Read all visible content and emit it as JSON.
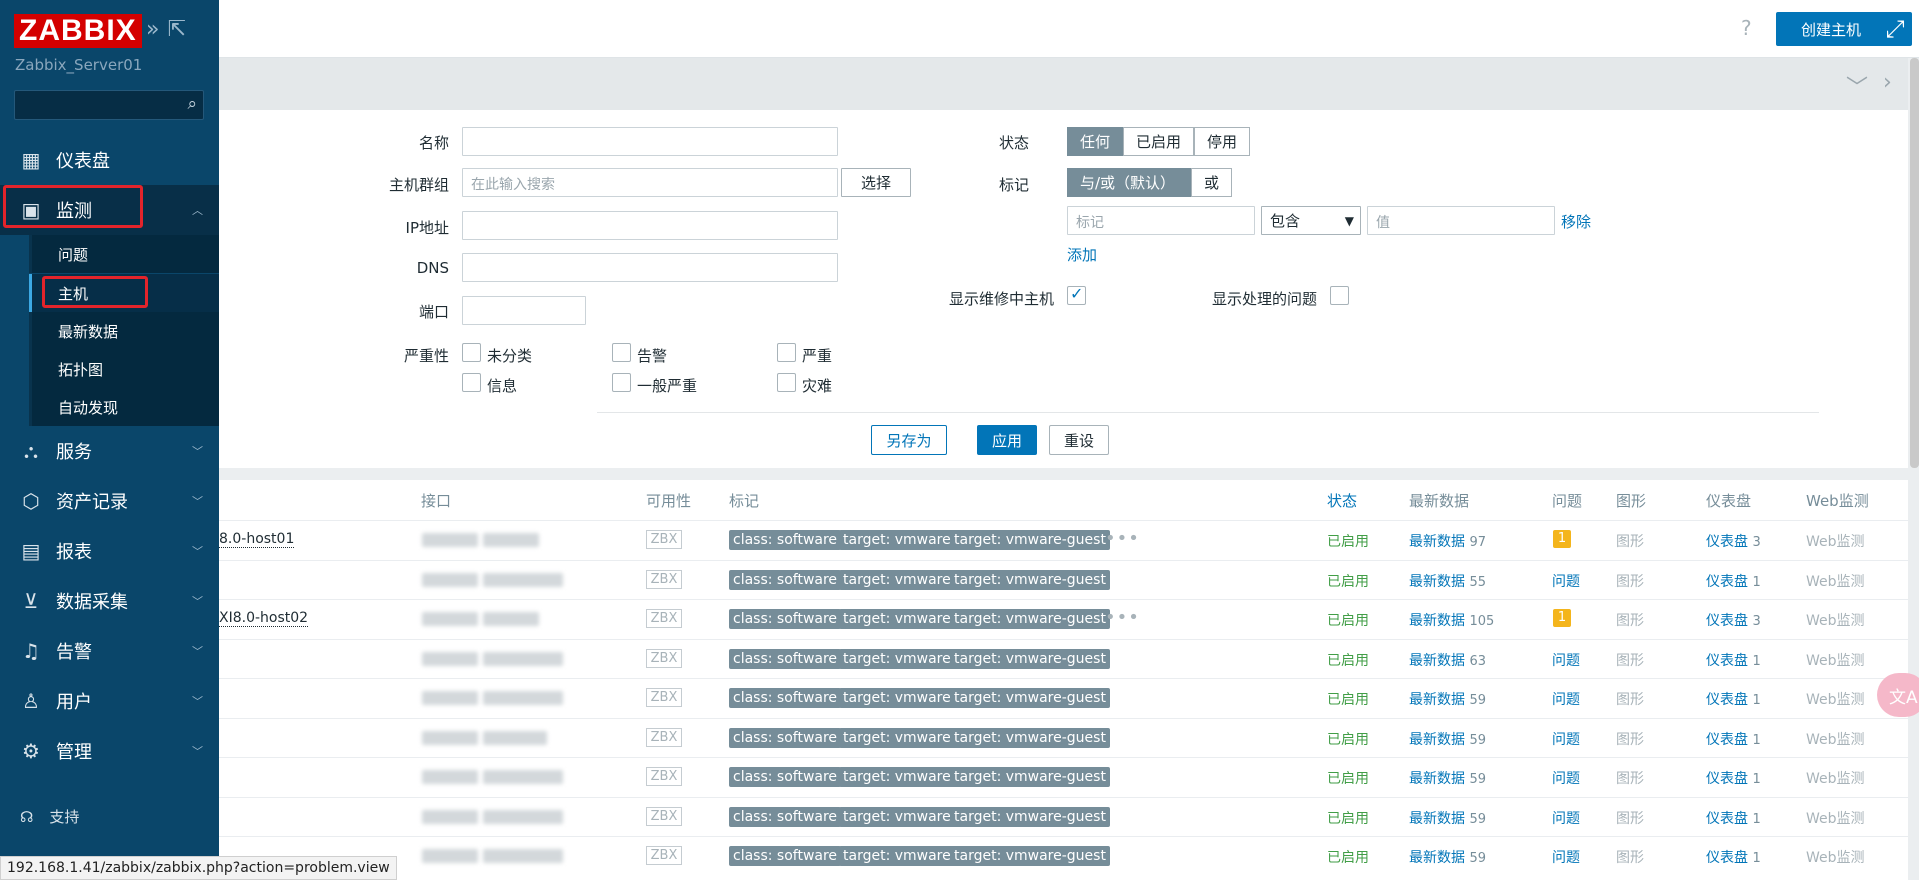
{
  "sidebar": {
    "logo": "ZABBIX",
    "server": "Zabbix_Server01",
    "menu": [
      {
        "label": "仪表盘",
        "icon": "dashboard-icon"
      },
      {
        "label": "监测",
        "icon": "monitoring-icon"
      },
      {
        "label": "服务",
        "icon": "services-icon"
      },
      {
        "label": "资产记录",
        "icon": "inventory-icon"
      },
      {
        "label": "报表",
        "icon": "reports-icon"
      },
      {
        "label": "数据采集",
        "icon": "data-collection-icon"
      },
      {
        "label": "告警",
        "icon": "alerts-icon"
      },
      {
        "label": "用户",
        "icon": "users-icon"
      },
      {
        "label": "管理",
        "icon": "administration-icon"
      }
    ],
    "submenu": [
      "问题",
      "主机",
      "最新数据",
      "拓扑图",
      "自动发现"
    ],
    "support": "支持"
  },
  "header": {
    "help": "?",
    "create_host": "创建主机"
  },
  "filter": {
    "name_label": "名称",
    "hostgroup_label": "主机群组",
    "hostgroup_placeholder": "在此输入搜索",
    "select_btn": "选择",
    "ip_label": "IP地址",
    "dns_label": "DNS",
    "port_label": "端口",
    "severity_label": "严重性",
    "severities": [
      "未分类",
      "告警",
      "严重",
      "信息",
      "一般严重",
      "灾难"
    ],
    "status_label": "状态",
    "status_options": [
      "任何",
      "已启用",
      "停用"
    ],
    "tags_label": "标记",
    "tags_options": [
      "与/或（默认）",
      "或"
    ],
    "tag_placeholder": "标记",
    "tag_operator": "包含",
    "value_placeholder": "值",
    "remove": "移除",
    "add": "添加",
    "show_maintenance": "显示维修中主机",
    "show_suppressed": "显示处理的问题",
    "save_as": "另存为",
    "apply": "应用",
    "reset": "重设"
  },
  "table": {
    "headers": [
      "接口",
      "可用性",
      "标记",
      "状态",
      "最新数据",
      "问题",
      "图形",
      "仪表盘",
      "Web监测"
    ],
    "availability": "ZBX",
    "tags": [
      "class: software",
      "target: vmware",
      "target: vmware-guest"
    ],
    "status": "已启用",
    "latest_label": "最新数据",
    "problems_label": "问题",
    "graphs_label": "图形",
    "dashboards_label": "仪表盘",
    "web_label": "Web监测",
    "rows": [
      {
        "name": "8.0-host01",
        "latest": "97",
        "problems": "1",
        "dashboards": "3",
        "more": true
      },
      {
        "name": "",
        "latest": "55",
        "problems": "",
        "dashboards": "1",
        "more": false
      },
      {
        "name": "XI8.0-host02",
        "latest": "105",
        "problems": "1",
        "dashboards": "3",
        "more": true
      },
      {
        "name": "",
        "latest": "63",
        "problems": "",
        "dashboards": "1",
        "more": false
      },
      {
        "name": "",
        "latest": "59",
        "problems": "",
        "dashboards": "1",
        "more": false
      },
      {
        "name": "",
        "latest": "59",
        "problems": "",
        "dashboards": "1",
        "more": false
      },
      {
        "name": "",
        "latest": "59",
        "problems": "",
        "dashboards": "1",
        "more": false
      },
      {
        "name": "",
        "latest": "59",
        "problems": "",
        "dashboards": "1",
        "more": false
      },
      {
        "name": "",
        "latest": "59",
        "problems": "",
        "dashboards": "1",
        "more": false
      }
    ]
  },
  "statusbar": "192.168.1.41/zabbix/zabbix.php?action=problem.view",
  "colors": {
    "sidebar": "#0a466a",
    "accent": "#0275b8",
    "highlight": "#e3242b",
    "enabled": "#429e47",
    "tag": "#768d99"
  }
}
